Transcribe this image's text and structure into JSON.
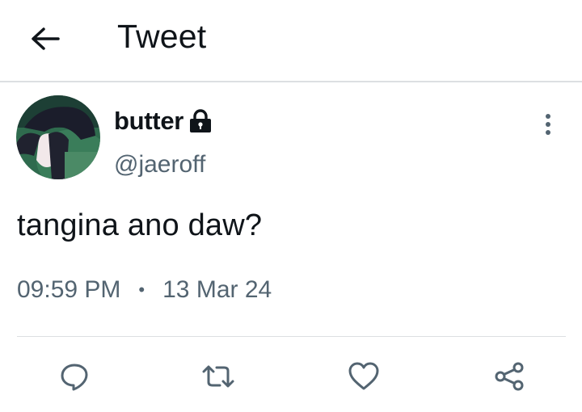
{
  "header": {
    "title": "Tweet",
    "back_icon": "arrow-left-icon"
  },
  "tweet": {
    "display_name": "butter",
    "protected_icon": "lock-icon",
    "handle": "@jaeroff",
    "text": "tangina ano daw?",
    "time": "09:59 PM",
    "separator": "•",
    "date": "13 Mar 24",
    "more_icon": "more-vertical-icon"
  },
  "actions": [
    {
      "name": "reply",
      "icon": "reply-icon"
    },
    {
      "name": "retweet",
      "icon": "retweet-icon"
    },
    {
      "name": "like",
      "icon": "heart-icon"
    },
    {
      "name": "share",
      "icon": "share-icon"
    }
  ],
  "colors": {
    "text_primary": "#0f1419",
    "text_secondary": "#536471",
    "divider": "#dcdfe2",
    "icon": "#536471"
  }
}
